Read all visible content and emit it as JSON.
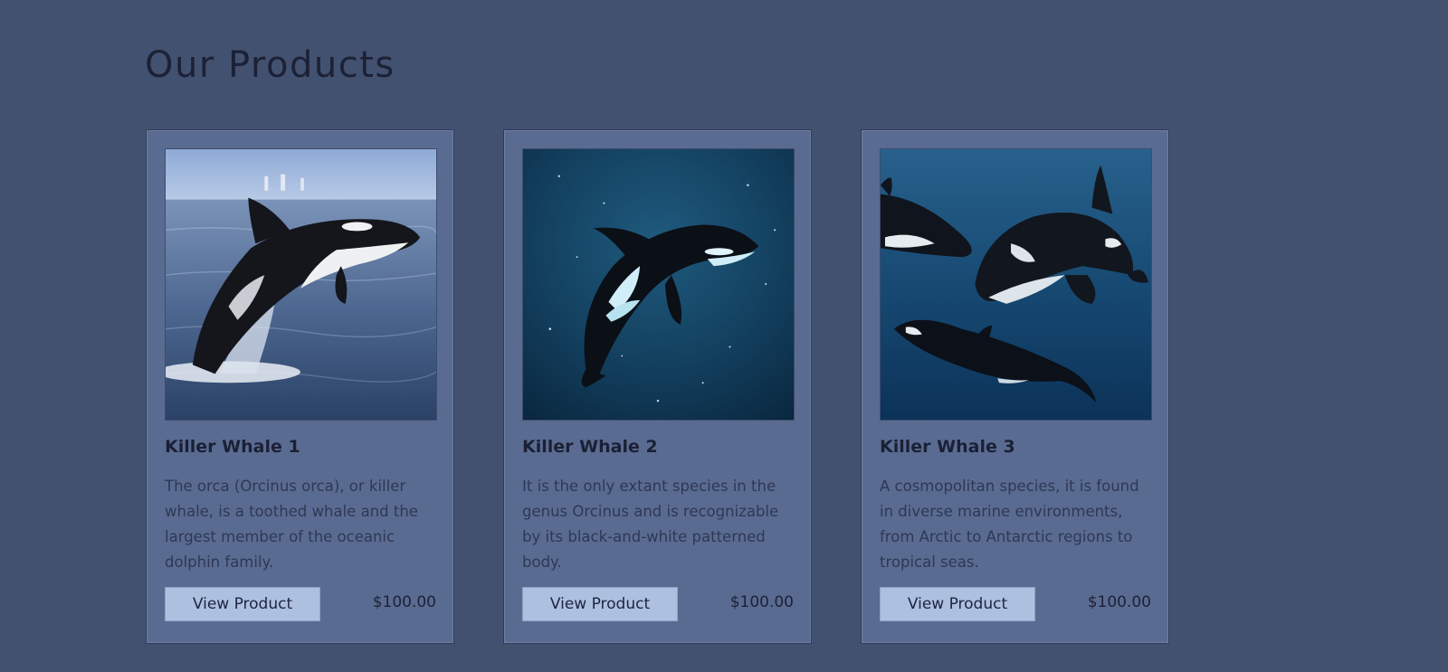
{
  "page": {
    "title": "Our Products"
  },
  "products": [
    {
      "name": "Killer Whale 1",
      "description": "The orca (Orcinus orca), or killer whale, is a toothed whale and the largest member of the oceanic dolphin family.",
      "button_label": "View Product",
      "price": "$100.00",
      "image": "orca-breaching-photo"
    },
    {
      "name": "Killer Whale 2",
      "description": "It is the only extant species in the genus Orcinus and is recognizable by its black-and-white patterned body.",
      "button_label": "View Product",
      "price": "$100.00",
      "image": "orca-underwater-photo"
    },
    {
      "name": "Killer Whale 3",
      "description": "A cosmopolitan species, it is found in diverse marine environments, from Arctic to Antarctic regions to tropical seas.",
      "button_label": "View Product",
      "price": "$100.00",
      "image": "orca-pod-photo"
    }
  ],
  "colors": {
    "background": "#435171",
    "card": "#5a6b92",
    "button": "#aec0e0",
    "text_dark": "#1b2035"
  }
}
